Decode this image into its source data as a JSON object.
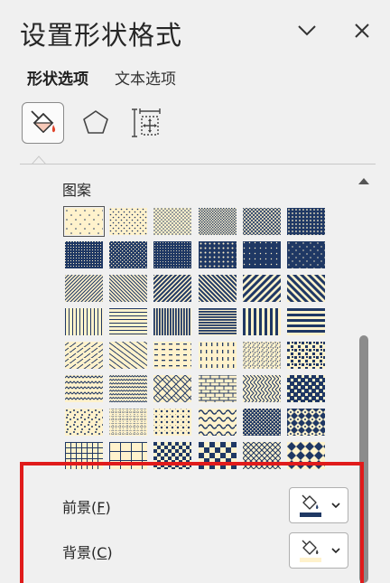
{
  "panel": {
    "title": "设置形状格式"
  },
  "tabs": [
    {
      "label": "形状选项"
    },
    {
      "label": "文本选项"
    }
  ],
  "pattern_section": {
    "label": "图案",
    "foreground_color": "#1f3864",
    "background_color": "#fff2cc"
  },
  "foreground": {
    "label": "前景(",
    "key": "F",
    "close": ")",
    "color": "#1f3864"
  },
  "background": {
    "label": "背景(",
    "key": "C",
    "close": ")",
    "color": "#fff2cc"
  },
  "colors": {
    "highlight_border": "#e01b1b",
    "panel_bg": "#f0f0f0"
  }
}
